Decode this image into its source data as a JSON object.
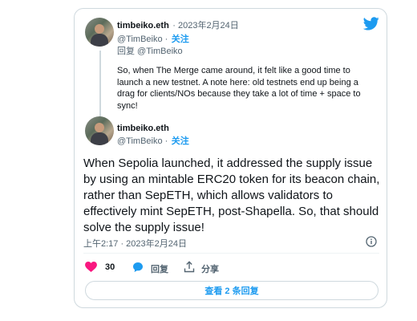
{
  "colors": {
    "accent": "#1d9bf0",
    "like": "#f91880",
    "text": "#0f1419",
    "muted": "#536471",
    "border": "#cfd9de"
  },
  "quoted_tweet": {
    "author_name": "timbeiko.eth",
    "date": "· 2023年2月24日",
    "handle": "@TimBeiko ·",
    "follow_label": "关注",
    "reply_to": "回复 @TimBeiko",
    "text": "So, when The Merge came around, it felt like a good time to launch a new testnet. A note here: old testnets end up being a drag for clients/NOs because they take a lot of time + space to sync!"
  },
  "main_tweet": {
    "author_name": "timbeiko.eth",
    "handle": "@TimBeiko ·",
    "follow_label": "关注",
    "text": "When Sepolia launched, it addressed the supply issue by using an mintable ERC20 token for its beacon chain, rather than SepETH, which allows validators to effectively mint SepETH, post-Shapella. So, that should solve the supply issue!",
    "timestamp": "上午2:17 · 2023年2月24日"
  },
  "actions": {
    "like_count": "30",
    "reply_label": "回复",
    "share_label": "分享"
  },
  "more_replies_label": "查看 2 条回复",
  "icons": [
    "twitter-bird-icon",
    "info-icon",
    "heart-icon",
    "reply-bubble-icon",
    "share-icon"
  ]
}
